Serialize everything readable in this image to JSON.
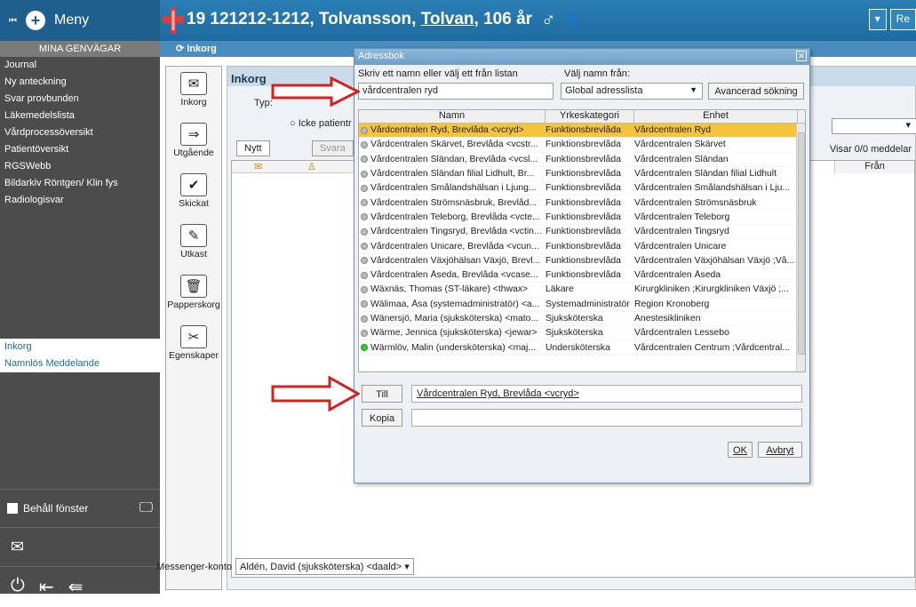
{
  "header": {
    "menu_label": "Meny",
    "patient_id": "19 121212-1212, Tolvansson,",
    "patient_name": "Tolvan",
    "patient_age": ", 106 år",
    "right_btn": "Re"
  },
  "sidebar": {
    "title": "MINA GENVÄGAR",
    "links": [
      "Journal",
      "Ny anteckning",
      "Svar provbunden",
      "Läkemedelslista",
      "Vårdprocessöversikt",
      "Patientöversikt",
      "RGSWebb",
      "Bildarkiv Röntgen/ Klin fys",
      "Radiologisvar"
    ],
    "inbox_links": [
      "Inkorg",
      "Namnlös Meddelande"
    ],
    "keep_window": "Behåll fönster"
  },
  "main": {
    "tab_label": "Inkorg",
    "panel_title": "Inkorg",
    "type_label": "Typ:",
    "radio2": "Icke patientr",
    "new_btn": "Nytt",
    "reply_btn": "Svara",
    "showing": "Visar 0/0 meddelar",
    "col_from": "Från",
    "tools": [
      "Inkorg",
      "Utgående",
      "Skickat",
      "Utkast",
      "Papperskorg",
      "Egenskaper"
    ],
    "messenger_label": "Messenger-konto",
    "messenger_value": "Aldén, David (sjuksköterska) <daald>"
  },
  "dialog": {
    "title": "Adressbok",
    "name_label": "Skriv ett namn eller välj ett från listan",
    "from_label": "Välj namn från:",
    "name_value": "vårdcentralen ryd",
    "from_value": "Global adresslista",
    "advanced_btn": "Avancerad sökning",
    "columns": [
      "Namn",
      "Yrkeskategori",
      "Enhet"
    ],
    "rows": [
      {
        "name": "Vårdcentralen Ryd, Brevlåda <vcryd>",
        "cat": "Funktionsbrevlåda",
        "unit": "Vårdcentralen Ryd",
        "selected": true
      },
      {
        "name": "Vårdcentralen Skärvet, Brevlåda <vcstr...",
        "cat": "Funktionsbrevlåda",
        "unit": "Vårdcentralen Skärvet"
      },
      {
        "name": "Vårdcentralen Sländan, Brevlåda <vcsl...",
        "cat": "Funktionsbrevlåda",
        "unit": "Vårdcentralen Sländan"
      },
      {
        "name": "Vårdcentralen Sländan filial Lidhult, Br...",
        "cat": "Funktionsbrevlåda",
        "unit": "Vårdcentralen Sländan filial Lidhult"
      },
      {
        "name": "Vårdcentralen Smålandshälsan i Ljung...",
        "cat": "Funktionsbrevlåda",
        "unit": "Vårdcentralen Smålandshälsan i Lju..."
      },
      {
        "name": "Vårdcentralen Strömsnäsbruk, Brevlåd...",
        "cat": "Funktionsbrevlåda",
        "unit": "Vårdcentralen Strömsnäsbruk"
      },
      {
        "name": "Vårdcentralen Teleborg, Brevlåda <vcte...",
        "cat": "Funktionsbrevlåda",
        "unit": "Vårdcentralen Teleborg"
      },
      {
        "name": "Vårdcentralen Tingsryd, Brevlåda <vctin...",
        "cat": "Funktionsbrevlåda",
        "unit": "Vårdcentralen Tingsryd"
      },
      {
        "name": "Vårdcentralen Unicare, Brevlåda <vcun...",
        "cat": "Funktionsbrevlåda",
        "unit": "Vårdcentralen Unicare"
      },
      {
        "name": "Vårdcentralen Växjöhälsan Växjö, Brevl...",
        "cat": "Funktionsbrevlåda",
        "unit": "Vårdcentralen Växjöhälsan Växjö ;Vå..."
      },
      {
        "name": "Vårdcentralen Åseda, Brevlåda <vcase...",
        "cat": "Funktionsbrevlåda",
        "unit": "Vårdcentralen Åseda"
      },
      {
        "name": "Wäxnäs, Thomas (ST-läkare) <thwax>",
        "cat": "Läkare",
        "unit": "Kirurgkliniken ;Kirurgkliniken Växjö ;..."
      },
      {
        "name": "Wälimaa, Åsa (systemadministratör) <a...",
        "cat": "Systemadministratör",
        "unit": "Region Kronoberg"
      },
      {
        "name": "Wänersjö, Maria (sjuksköterska) <mato...",
        "cat": "Sjuksköterska",
        "unit": "Anestesikliniken"
      },
      {
        "name": "Wärme, Jennica (sjuksköterska) <jewar>",
        "cat": "Sjuksköterska",
        "unit": "Vårdcentralen Lessebo"
      },
      {
        "name": "Wärmlöv, Malin (undersköterska) <maj...",
        "cat": "Undersköterska",
        "unit": "Vårdcentralen Centrum ;Vårdcentral...",
        "online": true
      }
    ],
    "to_btn": "Till",
    "to_value": "Vårdcentralen Ryd, Brevlåda <vcryd>",
    "cc_btn": "Kopia",
    "ok_btn": "OK",
    "cancel_btn": "Avbryt"
  },
  "colors": {
    "accent": "#1d6aa0",
    "selected_row": "#f5c43a",
    "arrow": "#d32020"
  }
}
